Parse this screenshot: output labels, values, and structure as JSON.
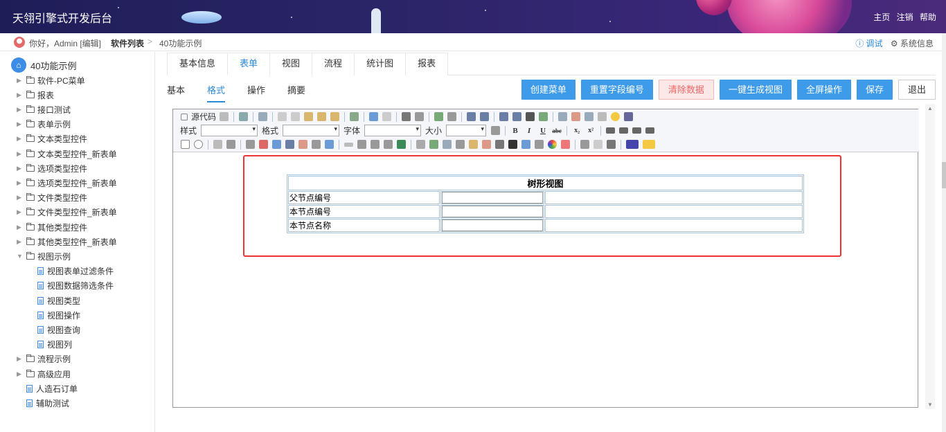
{
  "header": {
    "title": "天翎引擎式开发后台",
    "links": [
      "主页",
      "注销",
      "帮助"
    ]
  },
  "breadcrumb": {
    "greeting": "你好，Admin [编辑]",
    "item1": "软件列表",
    "separator": ">",
    "item2": "40功能示例",
    "debug": "ⓘ 调试",
    "system_info": "⚙ 系统信息"
  },
  "sidebar": {
    "root": "40功能示例",
    "home_icon": "home-icon",
    "items": [
      {
        "label": "软件-PC菜单",
        "type": "folder",
        "level": 1
      },
      {
        "label": "报表",
        "type": "folder",
        "level": 1
      },
      {
        "label": "接口测试",
        "type": "folder",
        "level": 1
      },
      {
        "label": "表单示例",
        "type": "folder",
        "level": 1
      },
      {
        "label": "文本类型控件",
        "type": "folder",
        "level": 1
      },
      {
        "label": "文本类型控件_新表单",
        "type": "folder",
        "level": 1
      },
      {
        "label": "选项类型控件",
        "type": "folder",
        "level": 1
      },
      {
        "label": "选项类型控件_新表单",
        "type": "folder",
        "level": 1
      },
      {
        "label": "文件类型控件",
        "type": "folder",
        "level": 1
      },
      {
        "label": "文件类型控件_新表单",
        "type": "folder",
        "level": 1
      },
      {
        "label": "其他类型控件",
        "type": "folder",
        "level": 1
      },
      {
        "label": "其他类型控件_新表单",
        "type": "folder",
        "level": 1
      },
      {
        "label": "视图示例",
        "type": "folder-open",
        "level": 1
      },
      {
        "label": "视图表单过滤条件",
        "type": "doc",
        "level": 2
      },
      {
        "label": "视图数据筛选条件",
        "type": "doc",
        "level": 2
      },
      {
        "label": "视图类型",
        "type": "doc",
        "level": 2
      },
      {
        "label": "视图操作",
        "type": "doc",
        "level": 2
      },
      {
        "label": "视图查询",
        "type": "doc",
        "level": 2
      },
      {
        "label": "视图列",
        "type": "doc",
        "level": 2
      },
      {
        "label": "流程示例",
        "type": "folder",
        "level": 1
      },
      {
        "label": "高级应用",
        "type": "folder",
        "level": 1
      },
      {
        "label": "人造石订单",
        "type": "doc",
        "level": 1
      },
      {
        "label": "辅助测试",
        "type": "doc",
        "level": 1
      }
    ]
  },
  "tabs": [
    "基本信息",
    "表单",
    "视图",
    "流程",
    "统计图",
    "报表"
  ],
  "active_tab": "表单",
  "subtabs": [
    "基本",
    "格式",
    "操作",
    "摘要"
  ],
  "active_subtab": "格式",
  "buttons": {
    "create_menu": "创建菜单",
    "reset_field_no": "重置字段编号",
    "clear_data": "清除数据",
    "gen_view": "一键生成视图",
    "fullscreen": "全屏操作",
    "save": "保存",
    "exit": "退出"
  },
  "toolbar": {
    "source": "源代码",
    "style_label": "样式",
    "format_label": "格式",
    "font_label": "字体",
    "size_label": "大小"
  },
  "form_table": {
    "title": "树形视图",
    "rows": [
      "父节点编号",
      "本节点编号",
      "本节点名称"
    ]
  },
  "colors": {
    "accent": "#3d9be9",
    "highlight_border": "#ee3333"
  }
}
